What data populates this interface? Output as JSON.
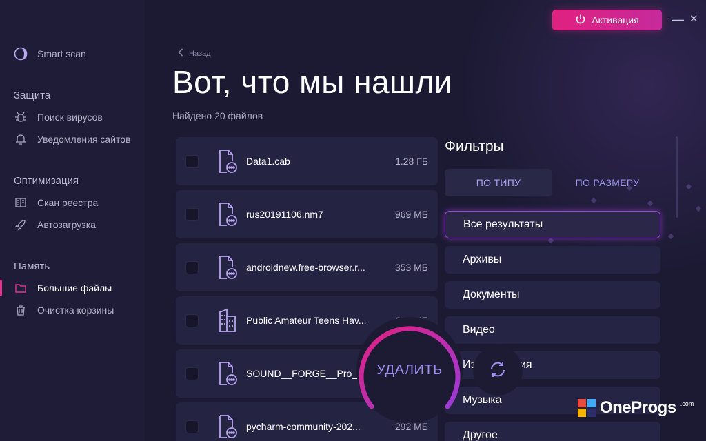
{
  "header": {
    "activate_label": "Активация",
    "minimize_glyph": "—",
    "close_glyph": "✕"
  },
  "sidebar": {
    "smart_scan": {
      "label": "Smart scan",
      "icon": "smart-scan-icon"
    },
    "sections": [
      {
        "title": "Защита",
        "items": [
          {
            "label": "Поиск вирусов",
            "icon": "bug-icon"
          },
          {
            "label": "Уведомления сайтов",
            "icon": "bell-icon"
          }
        ]
      },
      {
        "title": "Оптимизация",
        "items": [
          {
            "label": "Скан реестра",
            "icon": "registry-icon"
          },
          {
            "label": "Автозагрузка",
            "icon": "rocket-icon"
          }
        ]
      },
      {
        "title": "Память",
        "items": [
          {
            "label": "Большие файлы",
            "icon": "folder-icon",
            "active": true
          },
          {
            "label": "Очистка корзины",
            "icon": "trash-icon"
          }
        ]
      }
    ]
  },
  "main": {
    "back_label": "Назад",
    "title": "Вот, что мы нашли",
    "subtitle": "Найдено 20 файлов",
    "files": [
      {
        "name": "Data1.cab",
        "size": "1.28 ГБ",
        "icon": "file-icon"
      },
      {
        "name": "rus20191106.nm7",
        "size": "969 МБ",
        "icon": "file-icon"
      },
      {
        "name": "androidnew.free-browser.r...",
        "size": "353 МБ",
        "icon": "file-icon"
      },
      {
        "name": "Public Amateur Teens Hav...",
        "size": "311 МБ",
        "icon": "building-icon"
      },
      {
        "name": "SOUND__FORGE__Pro__1...",
        "size": "",
        "icon": "file-icon"
      },
      {
        "name": "pycharm-community-202...",
        "size": "292 МБ",
        "icon": "file-icon"
      }
    ],
    "delete_label": "УДАЛИТЬ"
  },
  "filters": {
    "title": "Фильтры",
    "tabs": [
      "ПО ТИПУ",
      "ПО РАЗМЕРУ"
    ],
    "items": [
      "Все результаты",
      "Архивы",
      "Документы",
      "Видео",
      "Изображения",
      "Музыка",
      "Другое"
    ]
  },
  "watermark": {
    "text": "OneProgs",
    "suffix": ".com"
  },
  "colors": {
    "accent": "#e0217f",
    "purple": "#9b90ee",
    "bg": "#1c1a33"
  }
}
